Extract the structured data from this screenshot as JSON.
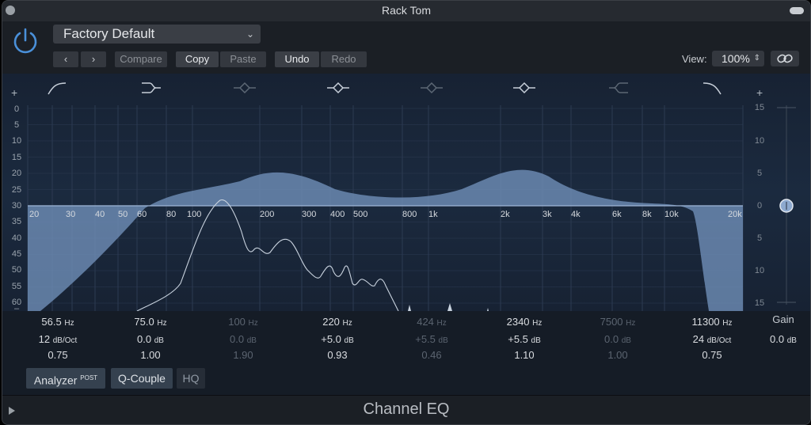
{
  "window": {
    "title": "Rack Tom"
  },
  "header": {
    "preset": "Factory Default",
    "compare": "Compare",
    "copy": "Copy",
    "paste": "Paste",
    "undo": "Undo",
    "redo": "Redo",
    "view_label": "View:",
    "view_value": "100%"
  },
  "scale": {
    "left": [
      "+",
      "0",
      "5",
      "10",
      "15",
      "20",
      "25",
      "30",
      "35",
      "40",
      "45",
      "50",
      "55",
      "60",
      "–"
    ],
    "right": [
      "+",
      "15",
      "10",
      "5",
      "0",
      "5",
      "10",
      "15"
    ],
    "freqs": [
      "20",
      "30",
      "40",
      "50",
      "60",
      "80",
      "100",
      "200",
      "300",
      "400",
      "500",
      "800",
      "1k",
      "2k",
      "3k",
      "4k",
      "6k",
      "8k",
      "10k",
      "20k"
    ]
  },
  "bands": [
    {
      "freq": "56.5",
      "freq_unit": "Hz",
      "gain": "12",
      "gain_unit": "dB/Oct",
      "q": "0.75",
      "active": true
    },
    {
      "freq": "75.0",
      "freq_unit": "Hz",
      "gain": "0.0",
      "gain_unit": "dB",
      "q": "1.00",
      "active": true
    },
    {
      "freq": "100",
      "freq_unit": "Hz",
      "gain": "0.0",
      "gain_unit": "dB",
      "q": "1.90",
      "active": false
    },
    {
      "freq": "220",
      "freq_unit": "Hz",
      "gain": "+5.0",
      "gain_unit": "dB",
      "q": "0.93",
      "active": true
    },
    {
      "freq": "424",
      "freq_unit": "Hz",
      "gain": "+5.5",
      "gain_unit": "dB",
      "q": "0.46",
      "active": false
    },
    {
      "freq": "2340",
      "freq_unit": "Hz",
      "gain": "+5.5",
      "gain_unit": "dB",
      "q": "1.10",
      "active": true
    },
    {
      "freq": "7500",
      "freq_unit": "Hz",
      "gain": "0.0",
      "gain_unit": "dB",
      "q": "1.00",
      "active": false
    },
    {
      "freq": "11300",
      "freq_unit": "Hz",
      "gain": "24",
      "gain_unit": "dB/Oct",
      "q": "0.75",
      "active": true
    }
  ],
  "gain": {
    "label": "Gain",
    "value": "0.0",
    "unit": "dB"
  },
  "toggles": {
    "analyzer": "Analyzer",
    "analyzer_sup": "POST",
    "qcouple": "Q-Couple",
    "hq": "HQ"
  },
  "footer": {
    "plugin_name": "Channel EQ"
  },
  "colors": {
    "curve_fill": "#6f8fb8",
    "grid": "#2c3b52",
    "background": "#172233"
  }
}
